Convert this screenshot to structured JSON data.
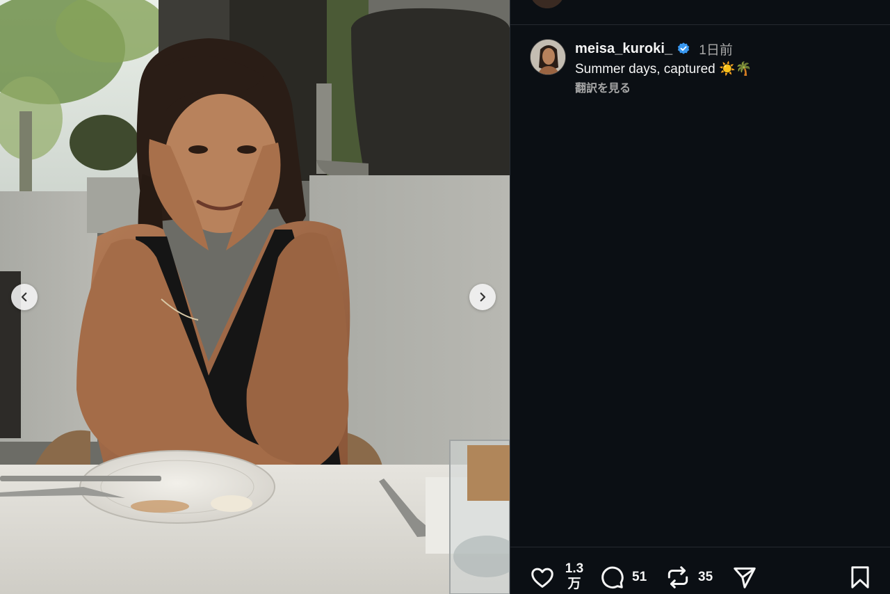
{
  "media": {
    "prev_button_icon": "chevron-left-icon",
    "next_button_icon": "chevron-right-icon"
  },
  "post": {
    "username": "meisa_kuroki_",
    "verified_icon": "verified-badge-icon",
    "verified_color": "#3897f0",
    "time": "1日前",
    "caption": "Summer days, captured ☀️🌴",
    "translate_label": "翻訳を見る"
  },
  "actions": {
    "like": {
      "icon": "heart-icon",
      "count_line1": "1.3",
      "count_line2": "万"
    },
    "comment": {
      "icon": "comment-icon",
      "count": "51"
    },
    "repost": {
      "icon": "repost-icon",
      "count": "35"
    },
    "share": {
      "icon": "send-icon"
    },
    "save": {
      "icon": "bookmark-icon"
    }
  },
  "colors": {
    "panel_background": "#0b0f14",
    "text_primary": "#f5f5f5",
    "text_secondary": "#a8a8a8"
  }
}
